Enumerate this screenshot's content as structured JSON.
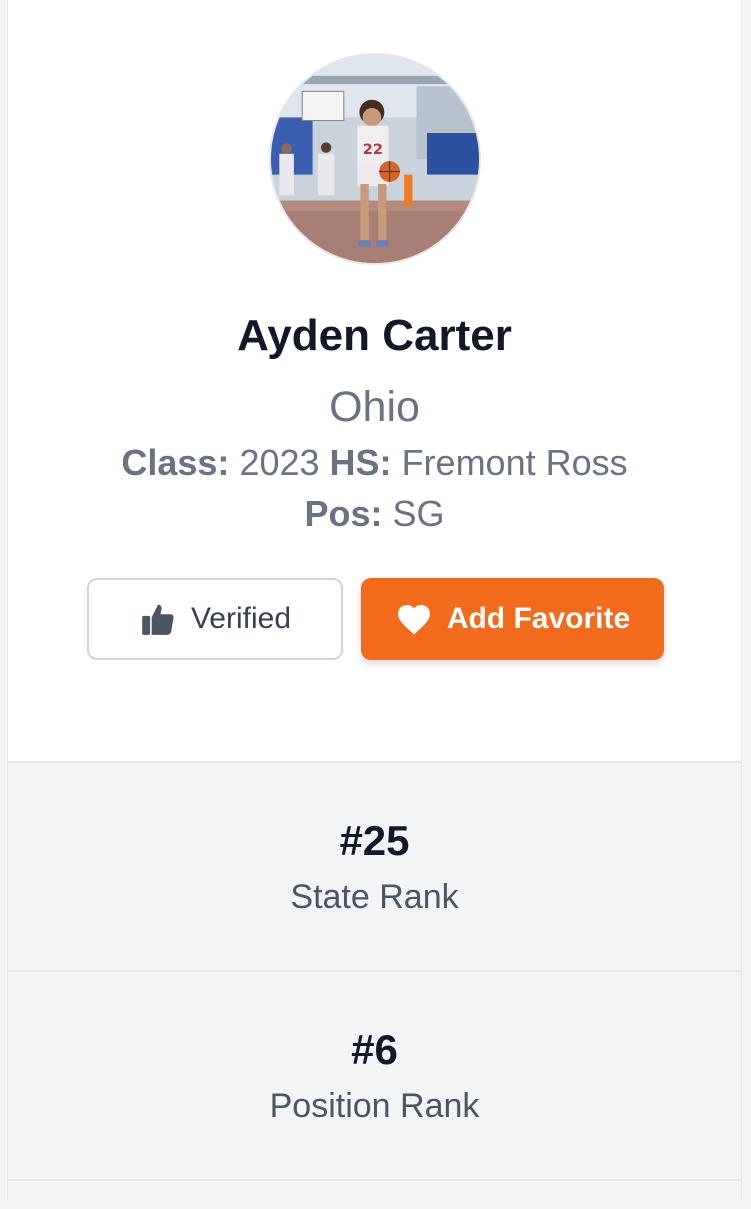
{
  "player": {
    "name": "Ayden Carter",
    "state": "Ohio",
    "class_label": "Class:",
    "class_value": "2023",
    "hs_label": "HS:",
    "hs_value": "Fremont Ross",
    "pos_label": "Pos:",
    "pos_value": "SG"
  },
  "actions": {
    "verified_label": "Verified",
    "verified_icon": "thumbs-up-icon",
    "favorite_label": "Add Favorite",
    "favorite_icon": "heart-icon"
  },
  "ranks": [
    {
      "value": "#25",
      "label": "State Rank"
    },
    {
      "value": "#6",
      "label": "Position Rank"
    }
  ],
  "colors": {
    "accent": "#f26b1d",
    "text_dark": "#111827",
    "text_muted": "#6b7280"
  }
}
